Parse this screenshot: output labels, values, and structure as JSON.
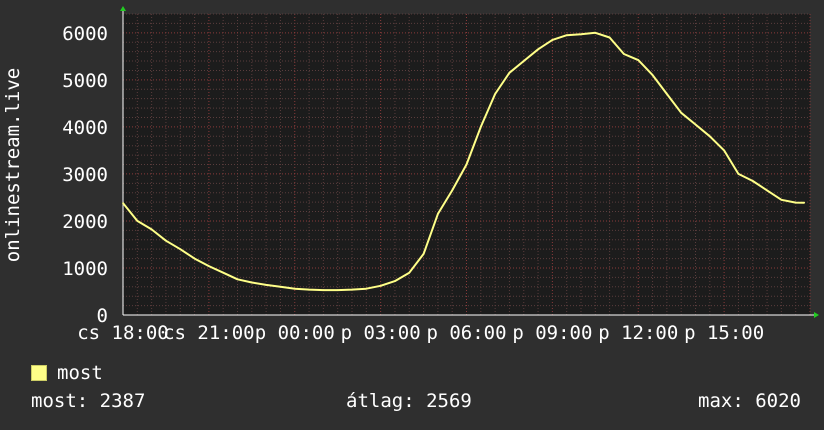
{
  "colors": {
    "background": "#2f2f2f",
    "plot_background": "#1c1c1c",
    "grid_minor": "#5a3d3d",
    "grid_major": "#8a3a3a",
    "line": "#ffff88",
    "axis_arrow": "#22cc22",
    "text": "#ffffff"
  },
  "chart_data": {
    "type": "line",
    "title": "",
    "ylabel": "onlinestream.live",
    "xlabel": "",
    "ylim": [
      0,
      6400
    ],
    "xlim": [
      0,
      24
    ],
    "grid": true,
    "y_ticks": [
      0,
      1000,
      2000,
      3000,
      4000,
      5000,
      6000
    ],
    "x_tick_labels": [
      {
        "x": 0,
        "label": "cs 18:00"
      },
      {
        "x": 3,
        "label": "cs 21:00"
      },
      {
        "x": 6,
        "label": "p 00:00"
      },
      {
        "x": 9,
        "label": "p 03:00"
      },
      {
        "x": 12,
        "label": "p 06:00"
      },
      {
        "x": 15,
        "label": "p 09:00"
      },
      {
        "x": 18,
        "label": "p 12:00"
      },
      {
        "x": 21,
        "label": "p 15:00"
      }
    ],
    "series": [
      {
        "name": "most",
        "x": [
          0,
          0.5,
          1,
          1.5,
          2,
          2.5,
          3,
          3.5,
          4,
          4.5,
          5,
          5.5,
          6,
          6.5,
          7,
          7.5,
          8,
          8.5,
          9,
          9.5,
          10,
          10.5,
          11,
          11.5,
          12,
          12.5,
          13,
          13.5,
          14,
          14.5,
          15,
          15.5,
          16,
          16.5,
          17,
          17.5,
          18,
          18.5,
          19,
          19.5,
          20,
          20.5,
          21,
          21.5,
          22,
          22.5,
          23,
          23.5,
          23.8
        ],
        "values": [
          2380,
          2000,
          1820,
          1580,
          1400,
          1200,
          1040,
          900,
          760,
          690,
          640,
          600,
          560,
          540,
          530,
          530,
          540,
          560,
          620,
          720,
          900,
          1300,
          2150,
          2650,
          3200,
          4000,
          4700,
          5150,
          5400,
          5650,
          5850,
          5950,
          5970,
          6000,
          5900,
          5550,
          5420,
          5100,
          4700,
          4300,
          4050,
          3800,
          3500,
          3000,
          2850,
          2650,
          2450,
          2390,
          2387
        ]
      }
    ],
    "legend": [
      "most"
    ],
    "legend_position": "bottom-left"
  },
  "legend": {
    "label": "most"
  },
  "stats": {
    "current": "most: 2387",
    "average": "átlag: 2569",
    "max": "max: 6020"
  }
}
